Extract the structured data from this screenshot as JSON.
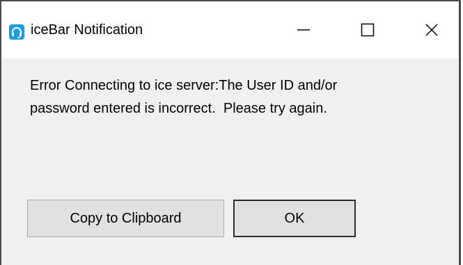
{
  "window": {
    "title": "iceBar Notification",
    "app_icon": "headset-icon",
    "controls": {
      "minimize_icon": "minimize-icon",
      "maximize_icon": "maximize-icon",
      "close_icon": "close-icon"
    }
  },
  "message": {
    "line1": "Error Connecting to ice server:The User ID and/or",
    "line2": "password entered is incorrect.  Please try again."
  },
  "buttons": {
    "copy_label": "Copy to Clipboard",
    "ok_label": "OK"
  },
  "colors": {
    "app_icon_bg": "#1a9fd8",
    "dialog_bg": "#f0f0f0",
    "titlebar_bg": "#ffffff",
    "button_bg": "#e1e1e1",
    "default_button_border": "#2b2b2b"
  }
}
